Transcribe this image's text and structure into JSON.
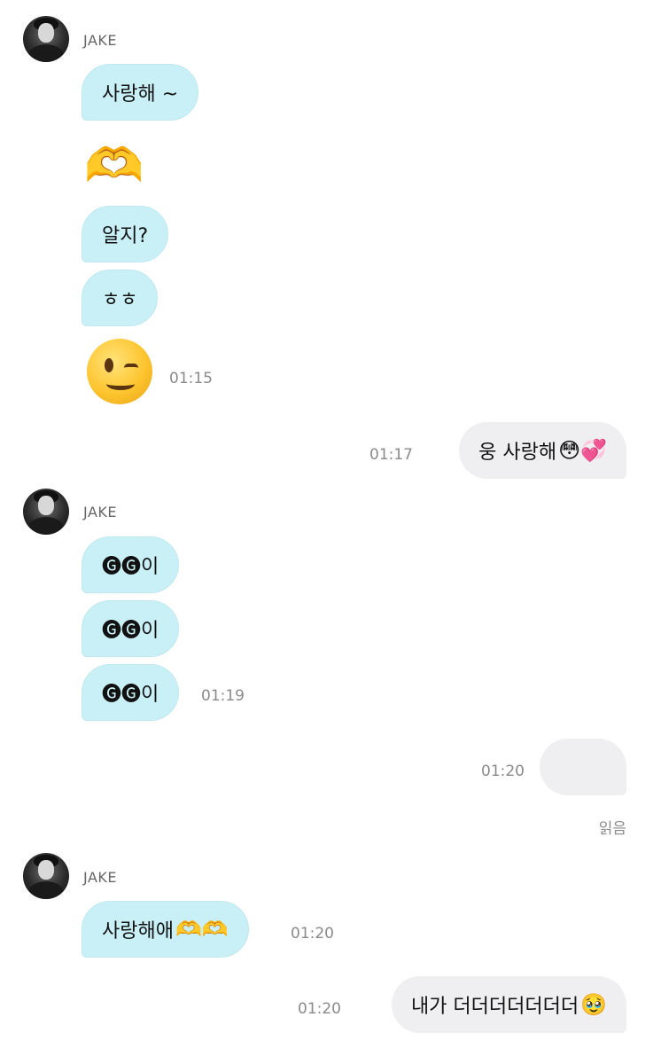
{
  "sender_name": "JAKE",
  "messages": {
    "m1": "사랑해 ~",
    "m2_emoji": "🫶",
    "m3": "알지?",
    "m4": "ㅎㅎ",
    "m5_emoji": "😉",
    "m5_time": "01:15",
    "out1_text": "웅 사랑해",
    "out1_emoji": "😳💞",
    "out1_time": "01:17",
    "m6_text": "🅖🅖이",
    "m7_text": "🅖🅖이",
    "m8_text": "🅖🅖이",
    "m8_time": "01:19",
    "out2_time": "01:20",
    "read_label": "읽음",
    "m9_text": "사랑해애",
    "m9_emoji": "🫶🫶",
    "m9_time": "01:20",
    "out3_text": "내가 더더더더더더더",
    "out3_emoji": "🥹",
    "out3_time": "01:20"
  },
  "colors": {
    "incoming_bubble": "#c9f0f6",
    "outgoing_bubble": "#efeff2",
    "timestamp": "#8a8a8a"
  }
}
